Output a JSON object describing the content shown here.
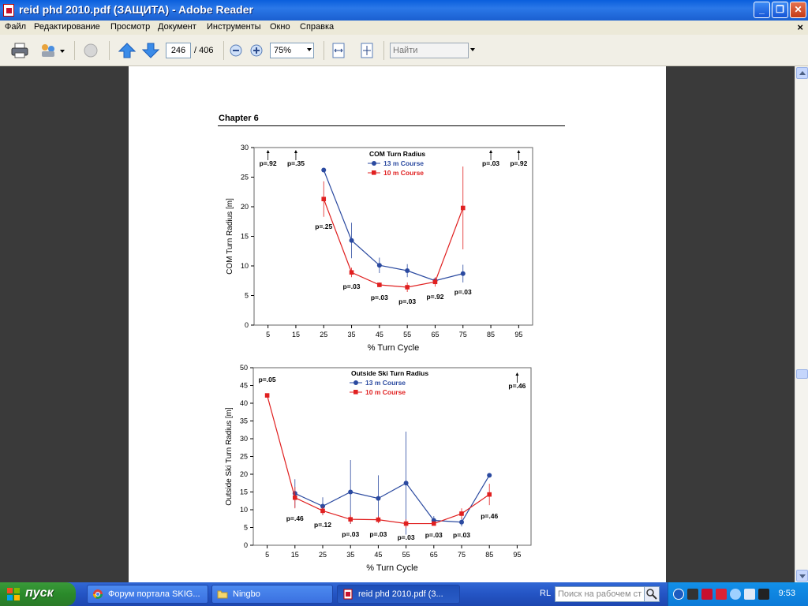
{
  "window": {
    "title": "reid phd 2010.pdf (ЗАЩИТА) - Adobe Reader",
    "minimize_glyph": "_",
    "maximize_glyph": "❐",
    "close_glyph": "✕"
  },
  "menu": {
    "items": [
      "Файл",
      "Редактирование",
      "Просмотр",
      "Документ",
      "Инструменты",
      "Окно",
      "Справка"
    ],
    "doc_close": "×"
  },
  "toolbar": {
    "current_page": "246",
    "total_pages": "/ 406",
    "zoom": "75%",
    "find_placeholder": "Найти"
  },
  "document": {
    "chapter": "Chapter 6"
  },
  "colors": {
    "series_13m": "#2b4aa0",
    "series_10m": "#e02020"
  },
  "chart_data": [
    {
      "type": "line",
      "title": "COM Turn Radius",
      "xlabel": "% Turn Cycle",
      "ylabel": "COM Turn Radius [m]",
      "x_ticks": [
        5,
        15,
        25,
        35,
        45,
        55,
        65,
        75,
        85,
        95
      ],
      "xlim": [
        0,
        100
      ],
      "ylim": [
        0,
        30
      ],
      "y_ticks": [
        0,
        5,
        10,
        15,
        20,
        25,
        30
      ],
      "legend": "top-center",
      "series": [
        {
          "name": "13 m Course",
          "color": "#2b4aa0",
          "x": [
            25,
            35,
            45,
            55,
            65,
            75
          ],
          "values": [
            26.2,
            14.3,
            10.1,
            9.2,
            7.5,
            8.7
          ],
          "error": [
            0,
            3.0,
            1.3,
            1.1,
            0.4,
            1.5
          ]
        },
        {
          "name": "10 m Course",
          "color": "#e02020",
          "x": [
            25,
            35,
            45,
            55,
            65,
            75
          ],
          "values": [
            21.3,
            8.9,
            6.8,
            6.4,
            7.3,
            19.8
          ],
          "error": [
            3.0,
            0.8,
            0.4,
            0.8,
            0.8,
            7.0
          ]
        }
      ],
      "annotations": [
        {
          "x": 5,
          "text": "p=.92",
          "arrow": true
        },
        {
          "x": 15,
          "text": "p=.35",
          "arrow": true
        },
        {
          "x": 25,
          "text": "p=.25"
        },
        {
          "x": 35,
          "text": "p=.03"
        },
        {
          "x": 45,
          "text": "p=.03"
        },
        {
          "x": 55,
          "text": "p=.03"
        },
        {
          "x": 65,
          "text": "p=.92"
        },
        {
          "x": 75,
          "text": "p=.03"
        },
        {
          "x": 85,
          "text": "p=.03",
          "arrow": true
        },
        {
          "x": 95,
          "text": "p=.92",
          "arrow": true
        }
      ]
    },
    {
      "type": "line",
      "title": "Outside Ski Turn Radius",
      "xlabel": "% Turn Cycle",
      "ylabel": "Outside Ski Turn Radius [m]",
      "x_ticks": [
        5,
        15,
        25,
        35,
        45,
        55,
        65,
        75,
        85,
        95
      ],
      "xlim": [
        0,
        100
      ],
      "ylim": [
        0,
        50
      ],
      "y_ticks": [
        0,
        5,
        10,
        15,
        20,
        25,
        30,
        35,
        40,
        45,
        50
      ],
      "legend": "top-center",
      "series": [
        {
          "name": "13 m Course",
          "color": "#2b4aa0",
          "x": [
            15,
            25,
            35,
            45,
            55,
            65,
            75,
            85
          ],
          "values": [
            14.6,
            11.0,
            15.0,
            13.2,
            17.5,
            7.0,
            6.5,
            19.7
          ],
          "error": [
            4.0,
            2.5,
            9.0,
            6.5,
            14.5,
            1.2,
            1.2,
            0
          ]
        },
        {
          "name": "10 m Course",
          "color": "#e02020",
          "x": [
            5,
            15,
            25,
            35,
            45,
            55,
            65,
            75,
            85
          ],
          "values": [
            42.2,
            13.4,
            9.7,
            7.3,
            7.2,
            6.1,
            6.1,
            8.9,
            14.3
          ],
          "error": [
            0,
            3.0,
            1.2,
            1.2,
            1.0,
            1.2,
            0.5,
            1.5,
            3.0
          ]
        }
      ],
      "annotations": [
        {
          "x": 5,
          "text": "p=.05"
        },
        {
          "x": 15,
          "text": "p=.46"
        },
        {
          "x": 25,
          "text": "p=.12"
        },
        {
          "x": 35,
          "text": "p=.03"
        },
        {
          "x": 45,
          "text": "p=.03"
        },
        {
          "x": 55,
          "text": "p=.03"
        },
        {
          "x": 65,
          "text": "p=.03"
        },
        {
          "x": 75,
          "text": "p=.03"
        },
        {
          "x": 85,
          "text": "p=.46"
        },
        {
          "x": 95,
          "text": "p=.46",
          "arrow": true
        }
      ]
    }
  ],
  "taskbar": {
    "start_label": "пуск",
    "tasks": [
      {
        "label": "Форум портала SKIG...",
        "icon": "chrome-icon"
      },
      {
        "label": "Ningbo",
        "icon": "folder-icon"
      },
      {
        "label": "reid phd 2010.pdf (3...",
        "icon": "adobe-reader-icon"
      }
    ],
    "language": "RL",
    "search_placeholder": "Поиск на рабочем ст",
    "clock": "9:53"
  }
}
